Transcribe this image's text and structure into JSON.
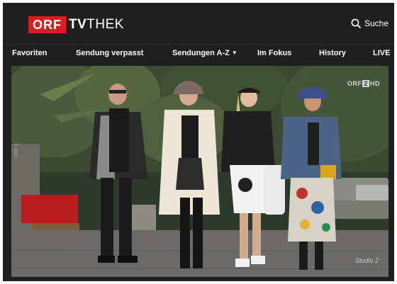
{
  "header": {
    "logo_box": "ORF",
    "logo_text_bold": "TV",
    "logo_text_rest": "THEK",
    "search_label": "Suche"
  },
  "nav": {
    "items": [
      {
        "label": "Favoriten"
      },
      {
        "label": "Sendung verpasst"
      },
      {
        "label": "Sendungen A-Z",
        "has_dropdown": true
      },
      {
        "label": "Im Fokus"
      },
      {
        "label": "History"
      },
      {
        "label": "LIVE"
      }
    ]
  },
  "player": {
    "channel_badge_prefix": "ORF",
    "channel_badge_number": "2",
    "channel_badge_suffix": "HD",
    "watermark": "Studio 2",
    "side_text": "ORF 2"
  },
  "colors": {
    "brand_red": "#e01a22",
    "background": "#1f1f1f",
    "text": "#ffffff"
  }
}
